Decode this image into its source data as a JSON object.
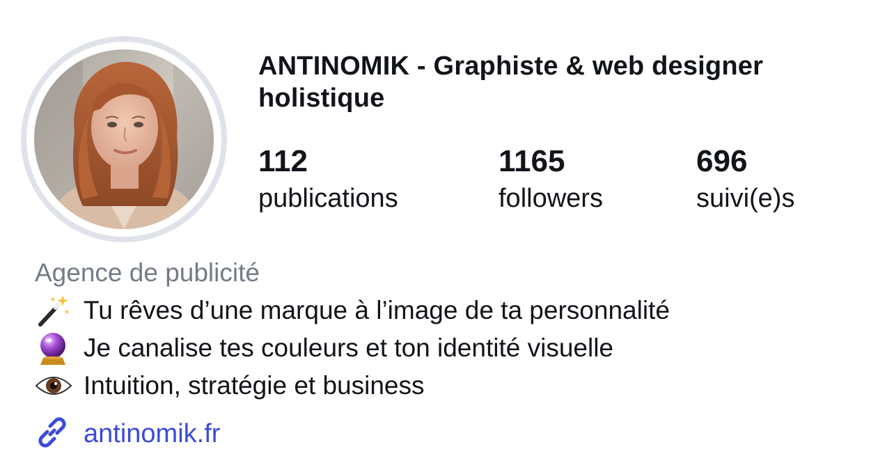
{
  "profile": {
    "name": "ANTINOMIK - Graphiste & web designer holistique",
    "avatar_icon": "profile-photo",
    "ring_color": "#dfe2e8"
  },
  "stats": {
    "posts": {
      "count": "112",
      "label": "publications"
    },
    "followers": {
      "count": "1165",
      "label": "followers"
    },
    "following": {
      "count": "696",
      "label": "suivi(e)s"
    }
  },
  "category": "Agence de publicité",
  "bio": [
    {
      "icon": "magic-wand-icon",
      "text": "Tu rêves d’une marque à l’image de ta personnalité"
    },
    {
      "icon": "crystal-ball-icon",
      "text": "Je canalise tes couleurs et ton identité visuelle"
    },
    {
      "icon": "eye-icon",
      "text": "Intuition, stratégie et business"
    }
  ],
  "link": {
    "icon": "link-icon",
    "text": "antinomik.fr",
    "color": "#3b4bd8"
  },
  "colors": {
    "text": "#111418",
    "muted": "#737b86",
    "accent": "#3b4bd8"
  }
}
